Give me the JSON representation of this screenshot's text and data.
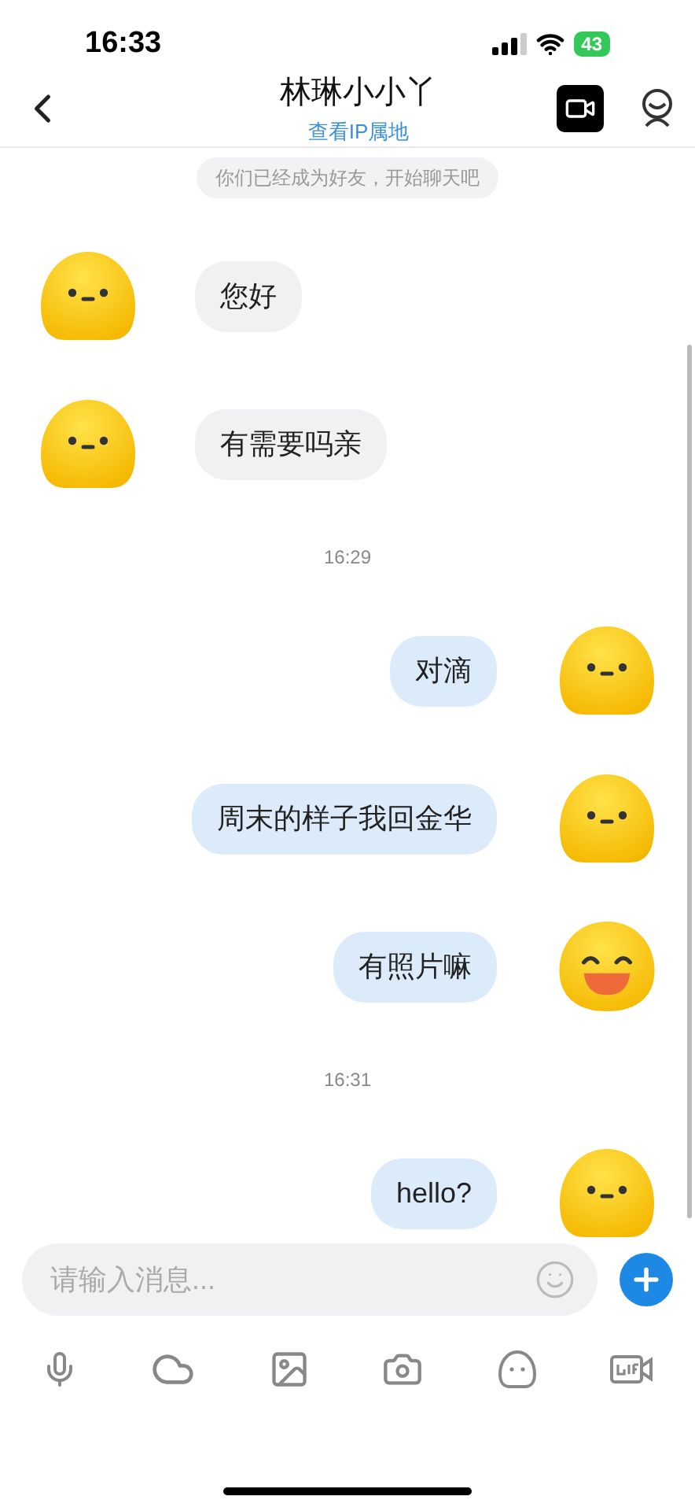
{
  "status_bar": {
    "time": "16:33",
    "battery": "43"
  },
  "header": {
    "title": "林琳小小丫",
    "subtitle": "查看IP属地"
  },
  "messages": [
    {
      "kind": "system",
      "text": "你们已经成为好友，开始聊天吧"
    },
    {
      "kind": "incoming",
      "text": "您好",
      "avatar": {
        "kind": "plain"
      }
    },
    {
      "kind": "incoming",
      "text": "有需要吗亲",
      "avatar": {
        "kind": "plain"
      }
    },
    {
      "kind": "time",
      "text": "16:29"
    },
    {
      "kind": "outgoing",
      "text": "对滴",
      "avatar": {
        "kind": "plain"
      }
    },
    {
      "kind": "outgoing",
      "text": "周末的样子我回金华",
      "avatar": {
        "kind": "plain"
      }
    },
    {
      "kind": "outgoing",
      "text": "有照片嘛",
      "avatar": {
        "kind": "laughing"
      }
    },
    {
      "kind": "time",
      "text": "16:31"
    },
    {
      "kind": "outgoing",
      "text": "hello?",
      "avatar": {
        "kind": "plain"
      }
    }
  ],
  "composer": {
    "placeholder": "请输入消息..."
  }
}
